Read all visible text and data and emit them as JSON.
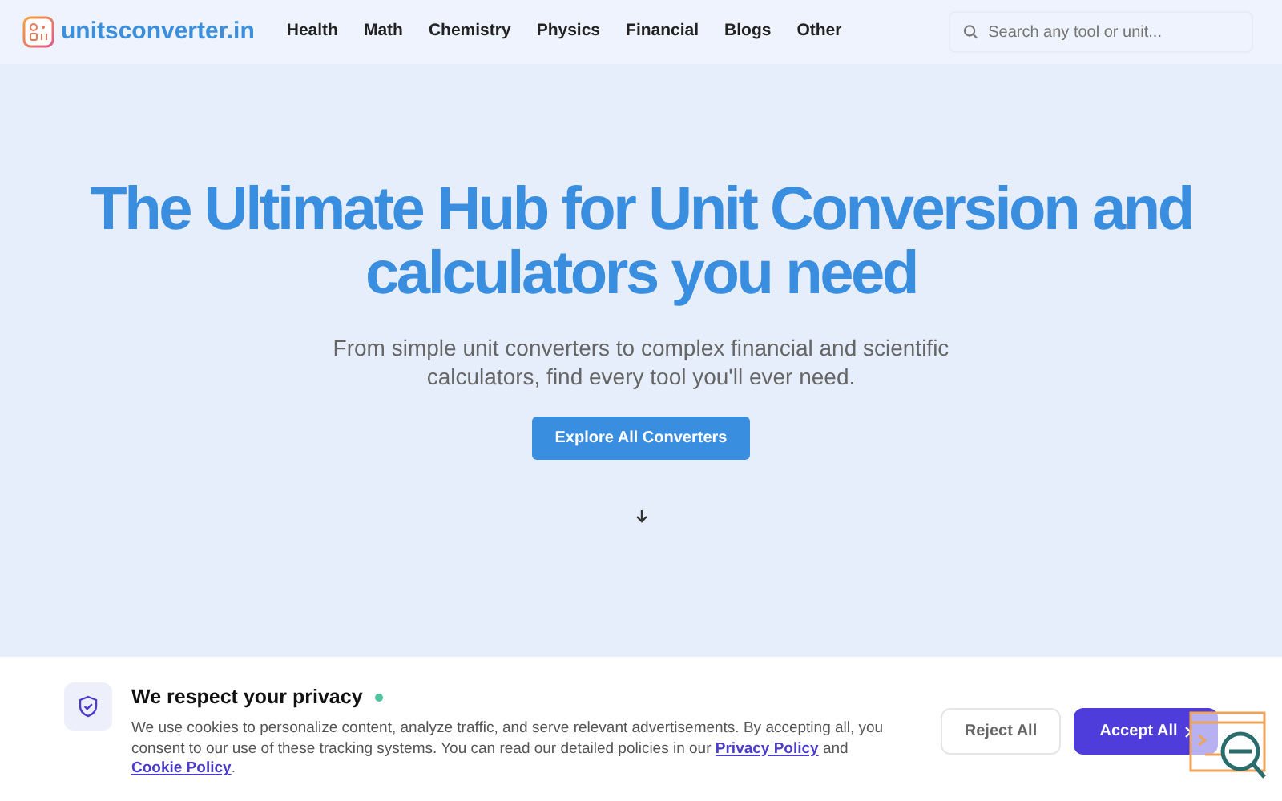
{
  "brand": {
    "name": "unitsconverter.in"
  },
  "nav": [
    {
      "label": "Health"
    },
    {
      "label": "Math"
    },
    {
      "label": "Chemistry"
    },
    {
      "label": "Physics"
    },
    {
      "label": "Financial"
    },
    {
      "label": "Blogs"
    },
    {
      "label": "Other"
    }
  ],
  "search": {
    "placeholder": "Search any tool or unit..."
  },
  "hero": {
    "title": "The Ultimate Hub for Unit Conversion and calculators you need",
    "subtitle": "From simple unit converters to complex financial and scientific calculators, find every tool you'll ever need.",
    "button": "Explore All Converters"
  },
  "cookie_banner": {
    "title": "We respect your privacy",
    "text": "We use cookies to personalize content, analyze traffic, and serve relevant advertisements. By accepting all, you consent to our use of these tracking systems. You can read our detailed policies in our ",
    "links": [
      {
        "label": "Privacy Policy"
      },
      {
        "label": "Cookie Policy"
      }
    ],
    "joiner": " and ",
    "end": ".",
    "reject": "Reject All",
    "accept": "Accept All"
  }
}
